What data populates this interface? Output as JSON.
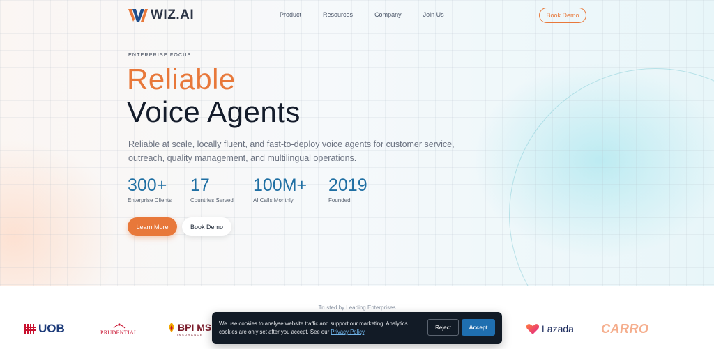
{
  "brand": {
    "logo_text": "WIZ.AI"
  },
  "nav": {
    "links": [
      "Product",
      "Resources",
      "Company",
      "Join Us"
    ],
    "book_demo": "Book Demo"
  },
  "hero": {
    "eyebrow": "ENTERPRISE FOCUS",
    "title_accent": "Reliable",
    "title_main": "Voice Agents",
    "subtitle": "Reliable at scale, locally fluent, and fast-to-deploy voice agents for customer service, outreach, quality management, and multilingual operations.",
    "stats": [
      {
        "value": "300+",
        "label": "Enterprise Clients"
      },
      {
        "value": "17",
        "label": "Countries Served"
      },
      {
        "value": "100M+",
        "label": "AI Calls Monthly"
      },
      {
        "value": "2019",
        "label": "Founded"
      }
    ],
    "learn_more": "Learn More",
    "book_demo": "Book Demo"
  },
  "trusted": {
    "label": "Trusted by Leading Enterprises",
    "logos": {
      "uob": "UOB",
      "prudential": "PRUDENTIAL",
      "bpi": "BPI MS",
      "bpi_sub": "INSURANCE",
      "lazada": "Lazada",
      "carro": "CARRO"
    }
  },
  "cookie": {
    "text_before": "We use cookies to analyse website traffic and support our marketing. Analytics cookies are only set after you accept. See our ",
    "link": "Privacy Policy",
    "text_after": ".",
    "reject": "Reject",
    "accept": "Accept"
  },
  "colors": {
    "accent": "#e8783a",
    "stat_blue": "#1f6fa3",
    "cookie_bg": "#121b26",
    "accept_blue": "#1f6fb0"
  }
}
